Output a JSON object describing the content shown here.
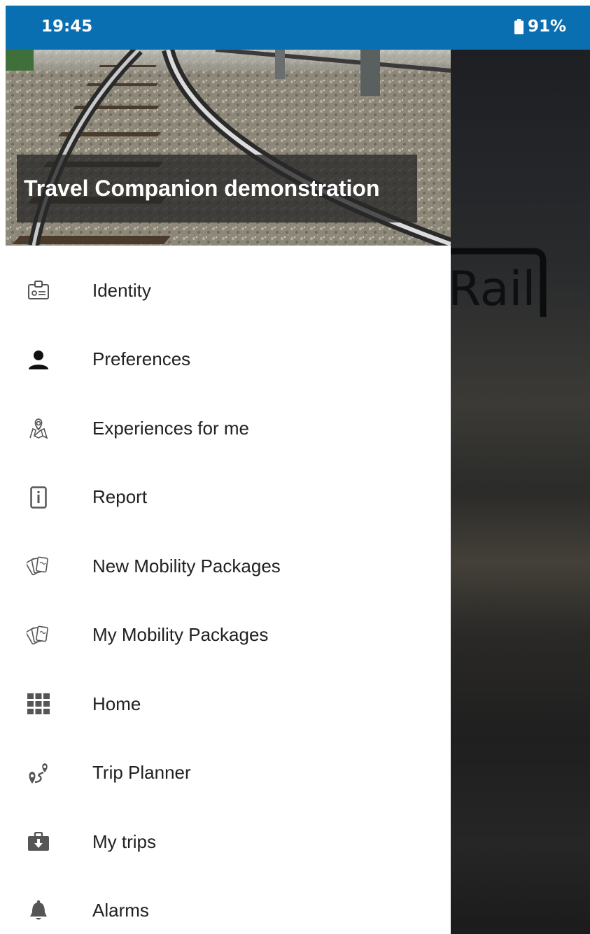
{
  "status_bar": {
    "time": "19:45",
    "battery": "91%"
  },
  "background_app": {
    "logo_text": "Rail"
  },
  "drawer": {
    "header_title": "Travel Companion demonstration",
    "items": [
      {
        "label": "Identity",
        "icon": "id-card-icon"
      },
      {
        "label": "Preferences",
        "icon": "person-icon"
      },
      {
        "label": "Experiences for me",
        "icon": "map-pin-icon"
      },
      {
        "label": "Report",
        "icon": "info-tablet-icon"
      },
      {
        "label": "New Mobility Packages",
        "icon": "cards-icon"
      },
      {
        "label": "My Mobility Packages",
        "icon": "cards-icon"
      },
      {
        "label": "Home",
        "icon": "grid-icon"
      },
      {
        "label": "Trip Planner",
        "icon": "route-icon"
      },
      {
        "label": "My trips",
        "icon": "briefcase-download-icon"
      },
      {
        "label": "Alarms",
        "icon": "bell-icon"
      }
    ]
  },
  "colors": {
    "status_bar": "#0a6fb0",
    "icon": "#555555",
    "text": "#212121"
  }
}
